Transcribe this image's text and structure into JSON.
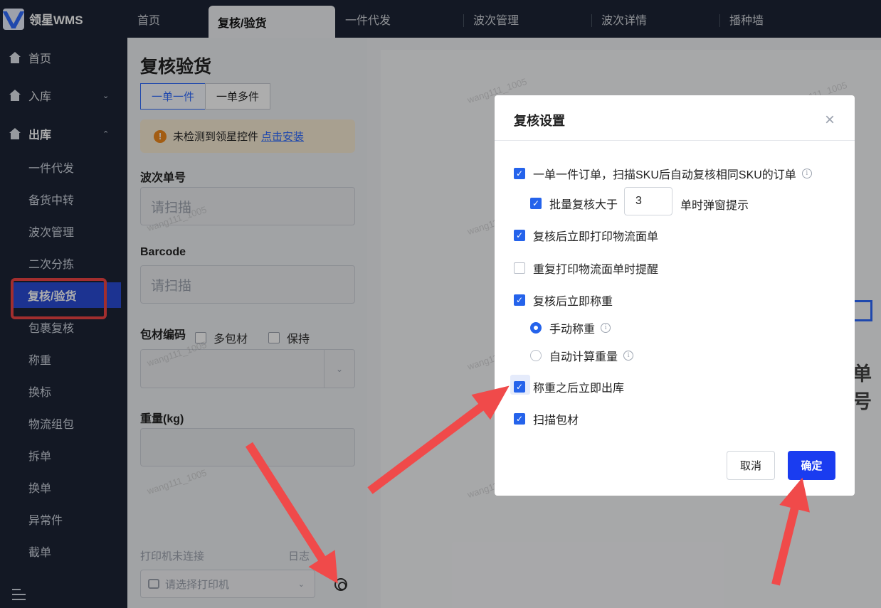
{
  "app": {
    "logo_text": "领星WMS"
  },
  "tabs": [
    {
      "label": "首页"
    },
    {
      "label": "复核/验货"
    },
    {
      "label": "一件代发"
    },
    {
      "label": "波次管理"
    },
    {
      "label": "波次详情"
    },
    {
      "label": "播种墙"
    }
  ],
  "sidebar": {
    "home": "首页",
    "inbound": "入库",
    "outbound": "出库",
    "items": [
      {
        "label": "一件代发"
      },
      {
        "label": "备货中转"
      },
      {
        "label": "波次管理"
      },
      {
        "label": "二次分拣"
      },
      {
        "label": "复核/验货"
      },
      {
        "label": "包裹复核"
      },
      {
        "label": "称重"
      },
      {
        "label": "换标"
      },
      {
        "label": "物流组包"
      },
      {
        "label": "拆单"
      },
      {
        "label": "换单"
      },
      {
        "label": "异常件"
      },
      {
        "label": "截单"
      }
    ]
  },
  "panel": {
    "title": "复核验货",
    "seg_single": "一单一件",
    "seg_multi": "一单多件",
    "notice_text": "未检测到领星控件",
    "notice_link": "点击安装",
    "wave_label": "波次单号",
    "wave_placeholder": "请扫描",
    "barcode_label": "Barcode",
    "barcode_placeholder": "请扫描",
    "pkg_label": "包材编码",
    "multi_pkg": "多包材",
    "keep": "保持",
    "weight_label": "重量(kg)",
    "printer_status": "打印机未连接",
    "log_label": "日志",
    "printer_placeholder": "请选择打印机"
  },
  "right": {
    "partial_text": "单号"
  },
  "modal": {
    "title": "复核设置",
    "close": "×",
    "opt1": "一单一件订单，扫描SKU后自动复核相同SKU的订单",
    "opt1_sub_prefix": "批量复核大于",
    "opt1_sub_value": "3",
    "opt1_sub_suffix": "单时弹窗提示",
    "opt2": "复核后立即打印物流面单",
    "opt3": "重复打印物流面单时提醒",
    "opt4": "复核后立即称重",
    "radio_manual": "手动称重",
    "radio_auto": "自动计算重量",
    "opt5": "称重之后立即出库",
    "opt6": "扫描包材",
    "cancel": "取消",
    "ok": "确定"
  },
  "watermark": "wang111_1005",
  "colors": {
    "sidebar_bg": "#1c2436",
    "active_blue": "#2a4cd6",
    "primary": "#1a3cf0",
    "annotation": "#ef4444"
  }
}
